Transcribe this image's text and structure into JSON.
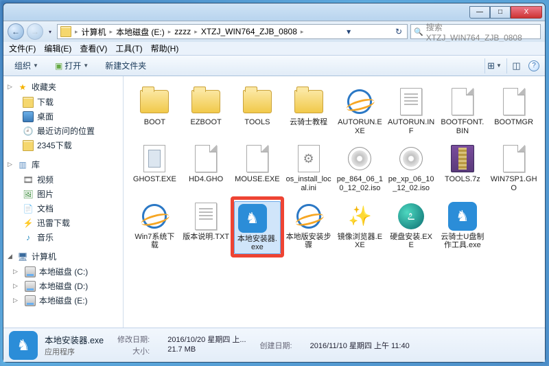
{
  "titlebar": {
    "min": "—",
    "max": "□",
    "close": "X"
  },
  "nav": {
    "back": "←",
    "fwd": "→",
    "drop": "▾",
    "refresh": "↻"
  },
  "breadcrumb": [
    "计算机",
    "本地磁盘 (E:)",
    "zzzz",
    "XTZJ_WIN764_ZJB_0808"
  ],
  "search": {
    "placeholder": "搜索 XTZJ_WIN764_ZJB_0808"
  },
  "menubar": [
    "文件(F)",
    "编辑(E)",
    "查看(V)",
    "工具(T)",
    "帮助(H)"
  ],
  "toolbar": {
    "organize": "组织",
    "open": "打开",
    "newfolder": "新建文件夹"
  },
  "sidebar": {
    "fav": {
      "label": "收藏夹",
      "downloads": "下载",
      "desktop": "桌面",
      "recent": "最近访问的位置",
      "d2345": "2345下载"
    },
    "lib": {
      "label": "库",
      "video": "视频",
      "pic": "图片",
      "doc": "文档",
      "thunder": "迅雷下载",
      "music": "音乐"
    },
    "pc": {
      "label": "计算机",
      "c": "本地磁盘 (C:)",
      "d": "本地磁盘 (D:)",
      "e": "本地磁盘 (E:)"
    }
  },
  "items": [
    {
      "name": "BOOT",
      "kind": "folder"
    },
    {
      "name": "EZBOOT",
      "kind": "folder"
    },
    {
      "name": "TOOLS",
      "kind": "folder"
    },
    {
      "name": "云骑士教程",
      "kind": "folder"
    },
    {
      "name": "AUTORUN.EXE",
      "kind": "ie"
    },
    {
      "name": "AUTORUN.INF",
      "kind": "txt"
    },
    {
      "name": "BOOTFONT.BIN",
      "kind": "blank"
    },
    {
      "name": "BOOTMGR",
      "kind": "blank"
    },
    {
      "name": "GHOST.EXE",
      "kind": "gho"
    },
    {
      "name": "HD4.GHO",
      "kind": "blank"
    },
    {
      "name": "MOUSE.EXE",
      "kind": "blank"
    },
    {
      "name": "os_install_local.ini",
      "kind": "ini"
    },
    {
      "name": "pe_864_06_10_12_02.iso",
      "kind": "iso"
    },
    {
      "name": "pe_xp_06_10_12_02.iso",
      "kind": "iso"
    },
    {
      "name": "TOOLS.7z",
      "kind": "rar"
    },
    {
      "name": "WIN7SP1.GHO",
      "kind": "blank"
    },
    {
      "name": "Win7系统下载",
      "kind": "ie"
    },
    {
      "name": "版本说明.TXT",
      "kind": "txt"
    },
    {
      "name": "本地安装器.exe",
      "kind": "horse",
      "highlight": true
    },
    {
      "name": "本地版安装步骤",
      "kind": "ie"
    },
    {
      "name": "镜像浏览器.EXE",
      "kind": "wand"
    },
    {
      "name": "硬盘安装.EXE",
      "kind": "swirl"
    },
    {
      "name": "云骑士U盘制作工具.exe",
      "kind": "horse"
    }
  ],
  "details": {
    "name": "本地安装器.exe",
    "type": "应用程序",
    "mod_k": "修改日期:",
    "mod_v": "2016/10/20 星期四 上...",
    "size_k": "大小:",
    "size_v": "21.7 MB",
    "create_k": "创建日期:",
    "create_v": "2016/11/10 星期四 上午 11:40"
  }
}
